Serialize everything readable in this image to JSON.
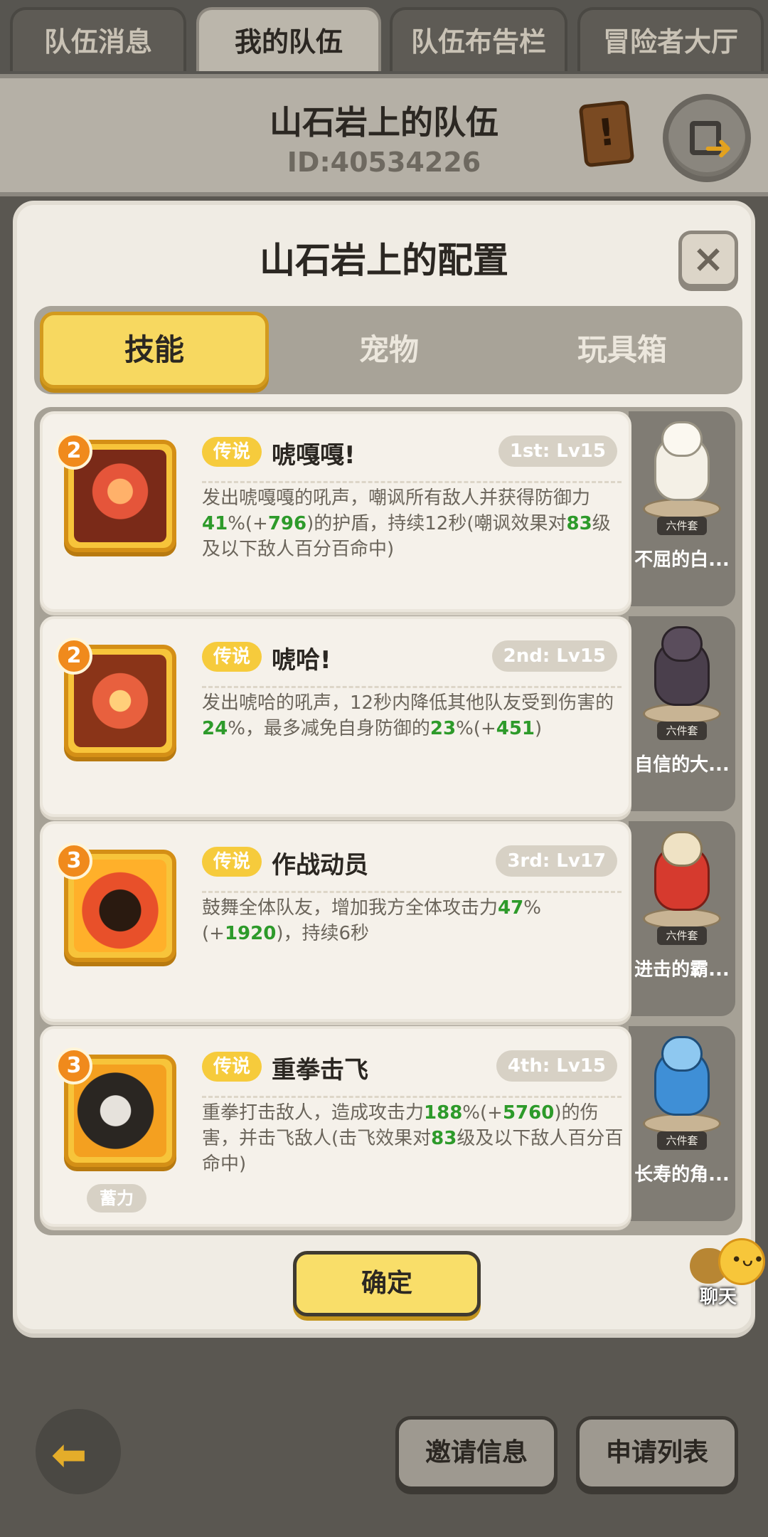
{
  "top_tabs": [
    "队伍消息",
    "我的队伍",
    "队伍布告栏",
    "冒险者大厅"
  ],
  "team": {
    "name": "山石岩上的队伍",
    "id": "ID:40534226"
  },
  "modal": {
    "title": "山石岩上的配置",
    "close": "×",
    "tabs": [
      "技能",
      "宠物",
      "玩具箱"
    ],
    "active_tab": "技能",
    "skills": [
      {
        "level": "2",
        "rarity": "传说",
        "name": "唬嘎嘎!",
        "slot": "1st: Lv15",
        "desc": [
          {
            "t": "发出唬嘎嘎的吼声，嘲讽所有敌人并获得防御力"
          },
          {
            "t": "41",
            "n": true
          },
          {
            "t": "%(+"
          },
          {
            "t": "796",
            "n": true
          },
          {
            "t": ")的护盾，持续12秒(嘲讽效果对"
          },
          {
            "t": "83",
            "n": true
          },
          {
            "t": "级及以下敌人百分百命中)"
          }
        ],
        "pet": {
          "badge": "六件套",
          "name": "不屈的白..."
        }
      },
      {
        "level": "2",
        "rarity": "传说",
        "name": "唬哈!",
        "slot": "2nd: Lv15",
        "desc": [
          {
            "t": "发出唬哈的吼声，12秒内降低其他队友受到伤害的"
          },
          {
            "t": "24",
            "n": true
          },
          {
            "t": "%，最多减免自身防御的"
          },
          {
            "t": "23",
            "n": true
          },
          {
            "t": "%(+"
          },
          {
            "t": "451",
            "n": true
          },
          {
            "t": ")"
          }
        ],
        "pet": {
          "badge": "六件套",
          "name": "自信的大..."
        }
      },
      {
        "level": "3",
        "rarity": "传说",
        "name": "作战动员",
        "slot": "3rd: Lv17",
        "desc": [
          {
            "t": "鼓舞全体队友，增加我方全体攻击力"
          },
          {
            "t": "47",
            "n": true
          },
          {
            "t": "%(+"
          },
          {
            "t": "1920",
            "n": true
          },
          {
            "t": ")，持续6秒"
          }
        ],
        "pet": {
          "badge": "六件套",
          "name": "进击的霸..."
        }
      },
      {
        "level": "3",
        "rarity": "传说",
        "name": "重拳击飞",
        "slot": "4th: Lv15",
        "tag": "蓄力",
        "desc": [
          {
            "t": "重拳打击敌人，造成攻击力"
          },
          {
            "t": "188",
            "n": true
          },
          {
            "t": "%(+"
          },
          {
            "t": "5760",
            "n": true
          },
          {
            "t": ")的伤害，并击飞敌人(击飞效果对"
          },
          {
            "t": "83",
            "n": true
          },
          {
            "t": "级及以下敌人百分百命中)"
          }
        ],
        "pet": {
          "badge": "六件套",
          "name": "长寿的角..."
        }
      }
    ],
    "confirm": "确定"
  },
  "chat": {
    "label": "聊天"
  },
  "bottom": {
    "invite": "邀请信息",
    "apply": "申请列表"
  },
  "icons": {
    "scroll": "scroll-icon",
    "exit": "exit-door-icon",
    "close": "close-icon",
    "back": "back-arrow-icon",
    "chat": "chat-bubble-icon"
  },
  "colors": {
    "accent_yellow": "#f7d860",
    "highlight_green": "#2d9a2a",
    "rarity_gold": "#f6cb3c"
  }
}
